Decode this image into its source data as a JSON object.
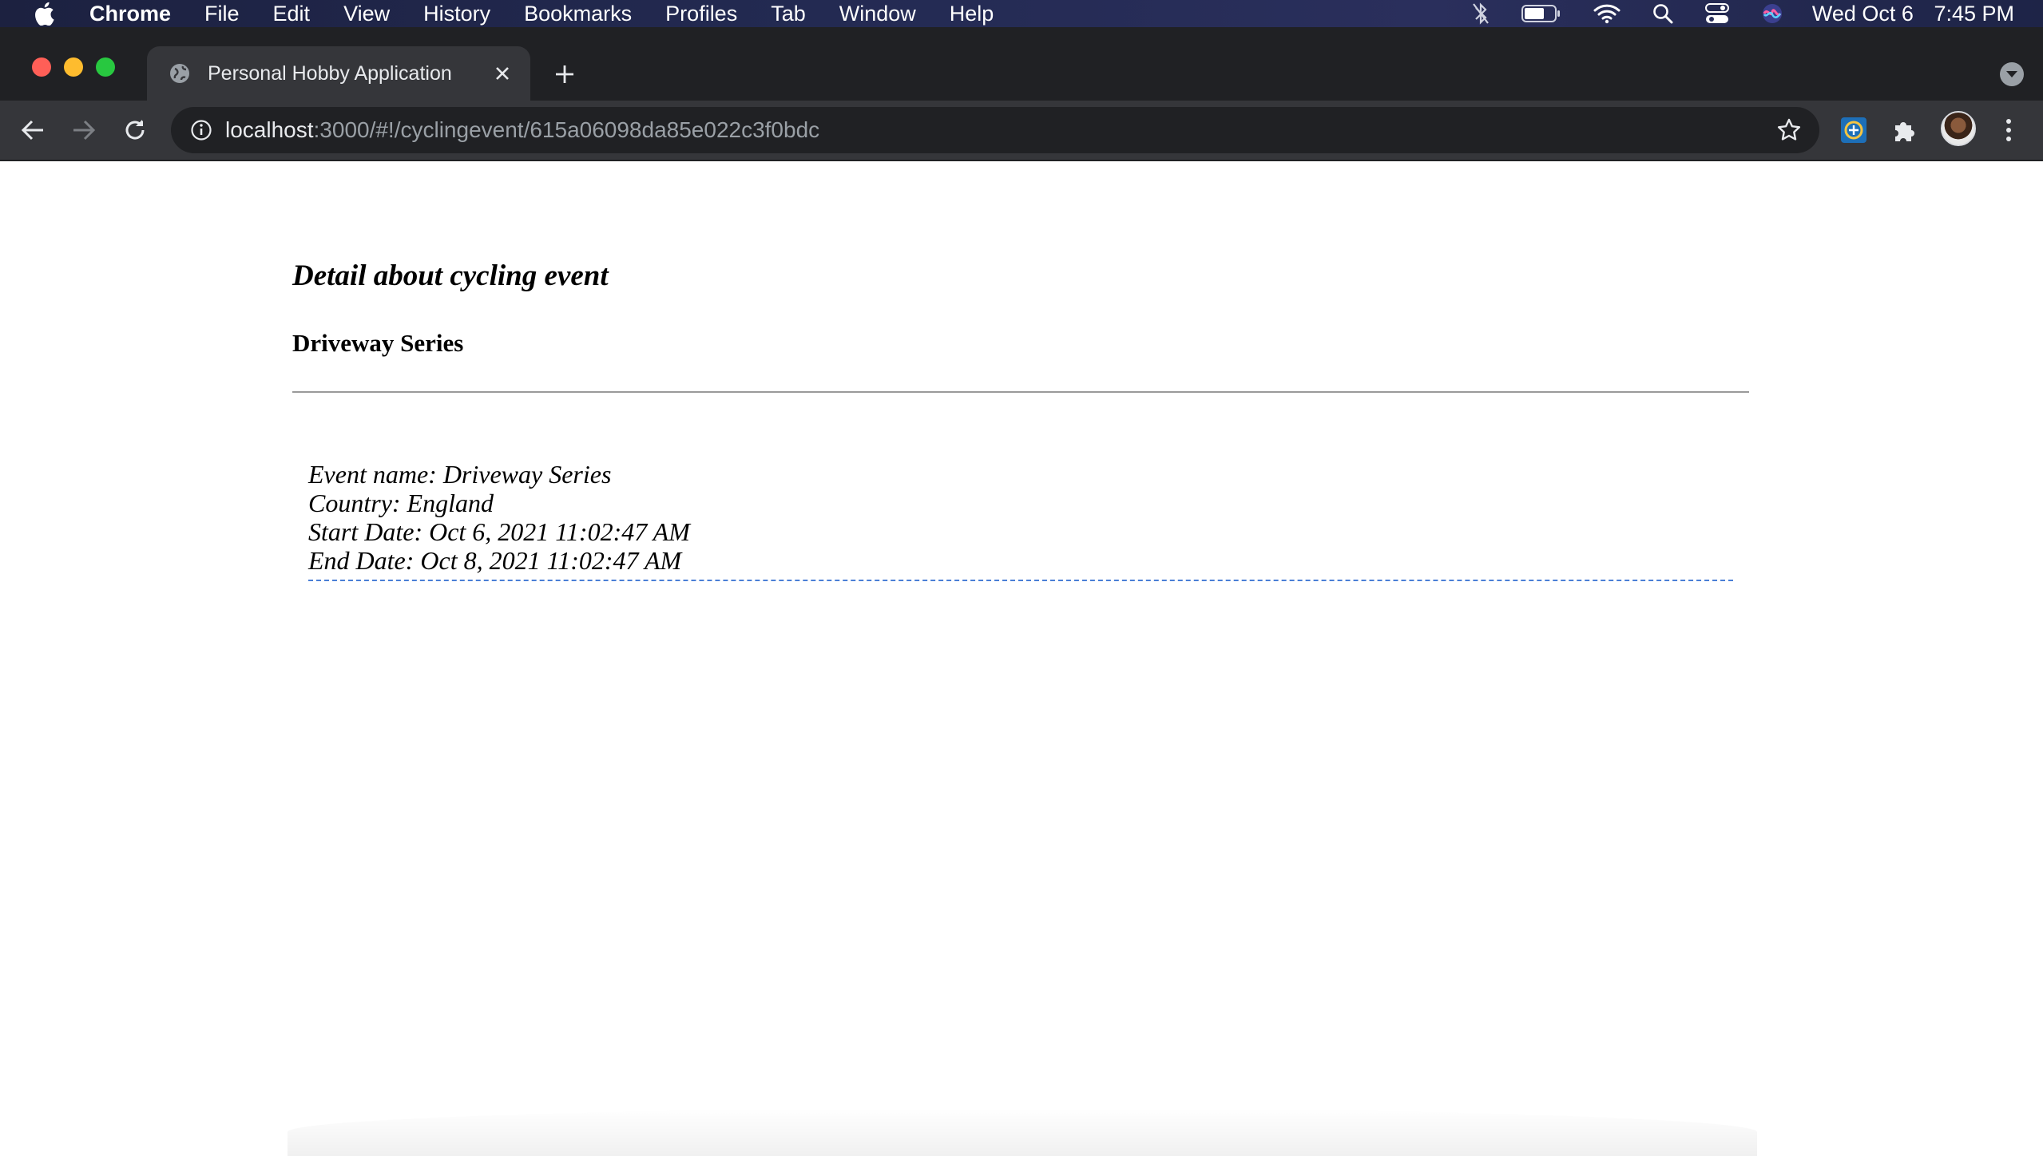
{
  "menubar": {
    "app_name": "Chrome",
    "items": [
      "File",
      "Edit",
      "View",
      "History",
      "Bookmarks",
      "Profiles",
      "Tab",
      "Window",
      "Help"
    ],
    "clock": {
      "date": "Wed Oct 6",
      "time": "7:45 PM"
    },
    "status_icons": [
      "apple-icon",
      "bluetooth-off-icon",
      "battery-icon",
      "wifi-icon",
      "spotlight-search-icon",
      "control-center-icon",
      "siri-icon"
    ]
  },
  "browser": {
    "tab": {
      "title": "Personal Hobby Application"
    },
    "address": {
      "host": "localhost",
      "rest": ":3000/#!/cyclingevent/615a06098da85e022c3f0bdc"
    }
  },
  "page": {
    "heading": "Detail about cycling event",
    "event_title": "Driveway Series",
    "details": {
      "event_name": "Event name: Driveway Series",
      "country": "Country: England",
      "start_date": "Start Date: Oct 6, 2021 11:02:47 AM",
      "end_date": "End Date: Oct 8, 2021 11:02:47 AM"
    }
  },
  "colors": {
    "menubar": "#232a52",
    "tabstrip": "#202124",
    "toolbar": "#35363a",
    "detail_border": "#4a7fd6"
  }
}
